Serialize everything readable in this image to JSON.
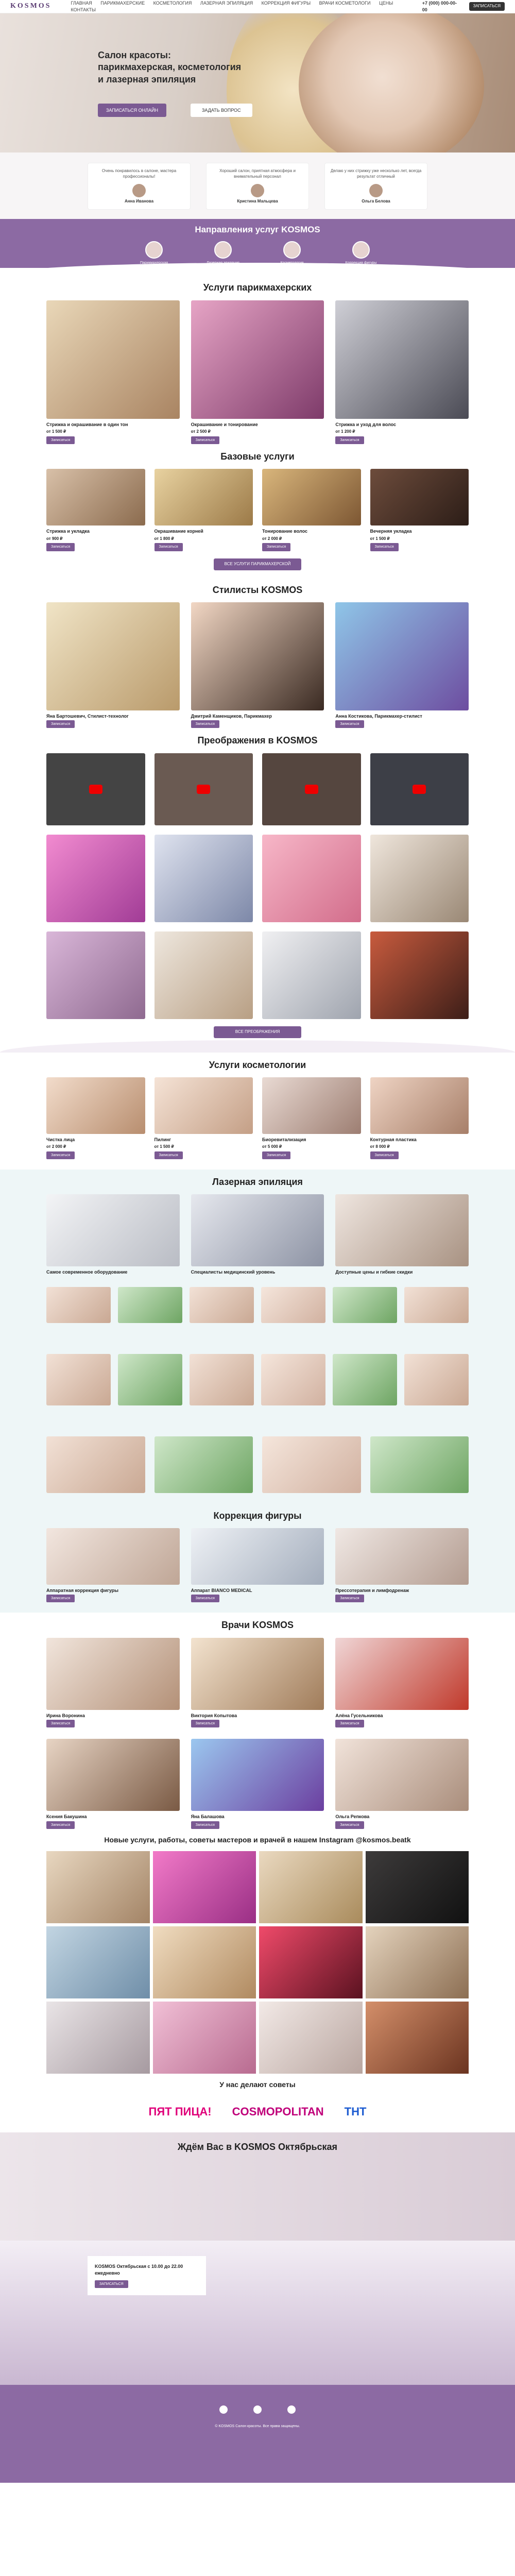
{
  "header": {
    "logo": "KOSMOS",
    "nav": [
      "ГЛАВНАЯ",
      "ПАРИКМАХЕРСКИЕ",
      "КОСМЕТОЛОГИЯ",
      "ЛАЗЕРНАЯ ЭПИЛЯЦИЯ",
      "КОРРЕКЦИЯ ФИГУРЫ",
      "ВРАЧИ КОСМЕТОЛОГИ",
      "ЦЕНЫ",
      "КОНТАКТЫ"
    ],
    "phone": "+7 (000) 000-00-00",
    "cta": "ЗАПИСАТЬСЯ"
  },
  "hero": {
    "title": "Салон красоты: парикмахерская, косметология и лазерная эпиляция",
    "btn1": "ЗАПИСАТЬСЯ ОНЛАЙН",
    "btn2": "ЗАДАТЬ ВОПРОС"
  },
  "reviews": [
    {
      "text": "Очень понравилось в салоне, мастера профессионалы!",
      "name": "Анна Иванова"
    },
    {
      "text": "Хороший салон, приятная атмосфера и внимательный персонал",
      "name": "Кристина Мальцева"
    },
    {
      "text": "Делаю у них стрижку уже несколько лет, всегда результат отличный",
      "name": "Ольга Белова"
    }
  ],
  "directions": {
    "title": "Направления услуг KOSMOS",
    "items": [
      "Парикмахерская",
      "Лазерная эпиляция",
      "Косметология",
      "Коррекция фигуры"
    ]
  },
  "hair": {
    "title": "Услуги парикмахерских",
    "items": [
      {
        "t": "Стрижка и окрашивание в один тон",
        "p": "от 1 500 ₽"
      },
      {
        "t": "Окрашивание и тонирование",
        "p": "от 2 500 ₽"
      },
      {
        "t": "Стрижка и уход для волос",
        "p": "от 1 200 ₽"
      }
    ]
  },
  "basic": {
    "title": "Базовые услуги",
    "items": [
      {
        "t": "Стрижка и укладка",
        "p": "от 900 ₽"
      },
      {
        "t": "Окрашивание корней",
        "p": "от 1 800 ₽"
      },
      {
        "t": "Тонирование волос",
        "p": "от 2 000 ₽"
      },
      {
        "t": "Вечерняя укладка",
        "p": "от 1 500 ₽"
      }
    ],
    "more": "ВСЕ УСЛУГИ ПАРИКМАХЕРСКОЙ"
  },
  "stylists": {
    "title": "Стилисты KOSMOS",
    "items": [
      {
        "t": "Яна Бартошевич, Стилист-технолог"
      },
      {
        "t": "Дмитрий Каменщиков, Парикмахер"
      },
      {
        "t": "Анна Костикова, Парикмахер-стилист"
      }
    ]
  },
  "transform": {
    "title": "Преображения в KOSMOS",
    "more": "ВСЕ ПРЕОБРАЖЕНИЯ"
  },
  "cosmo": {
    "title": "Услуги косметологии",
    "items": [
      {
        "t": "Чистка лица",
        "p": "от 2 000 ₽"
      },
      {
        "t": "Пилинг",
        "p": "от 1 500 ₽"
      },
      {
        "t": "Биоревитализация",
        "p": "от 5 000 ₽"
      },
      {
        "t": "Контурная пластика",
        "p": "от 8 000 ₽"
      }
    ]
  },
  "laser": {
    "title": "Лазерная эпиляция",
    "items": [
      {
        "t": "Самое современное оборудование"
      },
      {
        "t": "Специалисты медицинский уровень"
      },
      {
        "t": "Доступные цены и гибкие скидки"
      }
    ]
  },
  "figure": {
    "title": "Коррекция фигуры",
    "items": [
      {
        "t": "Аппаратная коррекция фигуры"
      },
      {
        "t": "Аппарат BIANCO MEDICAL"
      },
      {
        "t": "Прессотерапия и лимфодренаж"
      }
    ]
  },
  "doctors": {
    "title": "Врачи KOSMOS",
    "items": [
      {
        "t": "Ирина Воронина"
      },
      {
        "t": "Виктория Копытова"
      },
      {
        "t": "Алёна Гусельникова"
      },
      {
        "t": "Ксения Бакушина"
      },
      {
        "t": "Яна Балашова"
      },
      {
        "t": "Ольга Репкова"
      }
    ]
  },
  "insta": {
    "title": "Новые услуги, работы, советы мастеров и врачей в нашем Instagram @kosmos.beatk"
  },
  "media": {
    "title": "У нас делают советы",
    "logos": [
      "ПЯТ ПИЦА!",
      "COSMOPOLITAN",
      "ТНТ"
    ]
  },
  "salon": {
    "title": "Ждём Вас в KOSMOS Октябрьская",
    "addr": "KOSMOS Октябрьская с 10.00 до 22.00 ежедневно",
    "btn": "ЗАПИСАТЬСЯ"
  },
  "footer": {
    "text": "© KOSMOS Салон красоты. Все права защищены."
  }
}
